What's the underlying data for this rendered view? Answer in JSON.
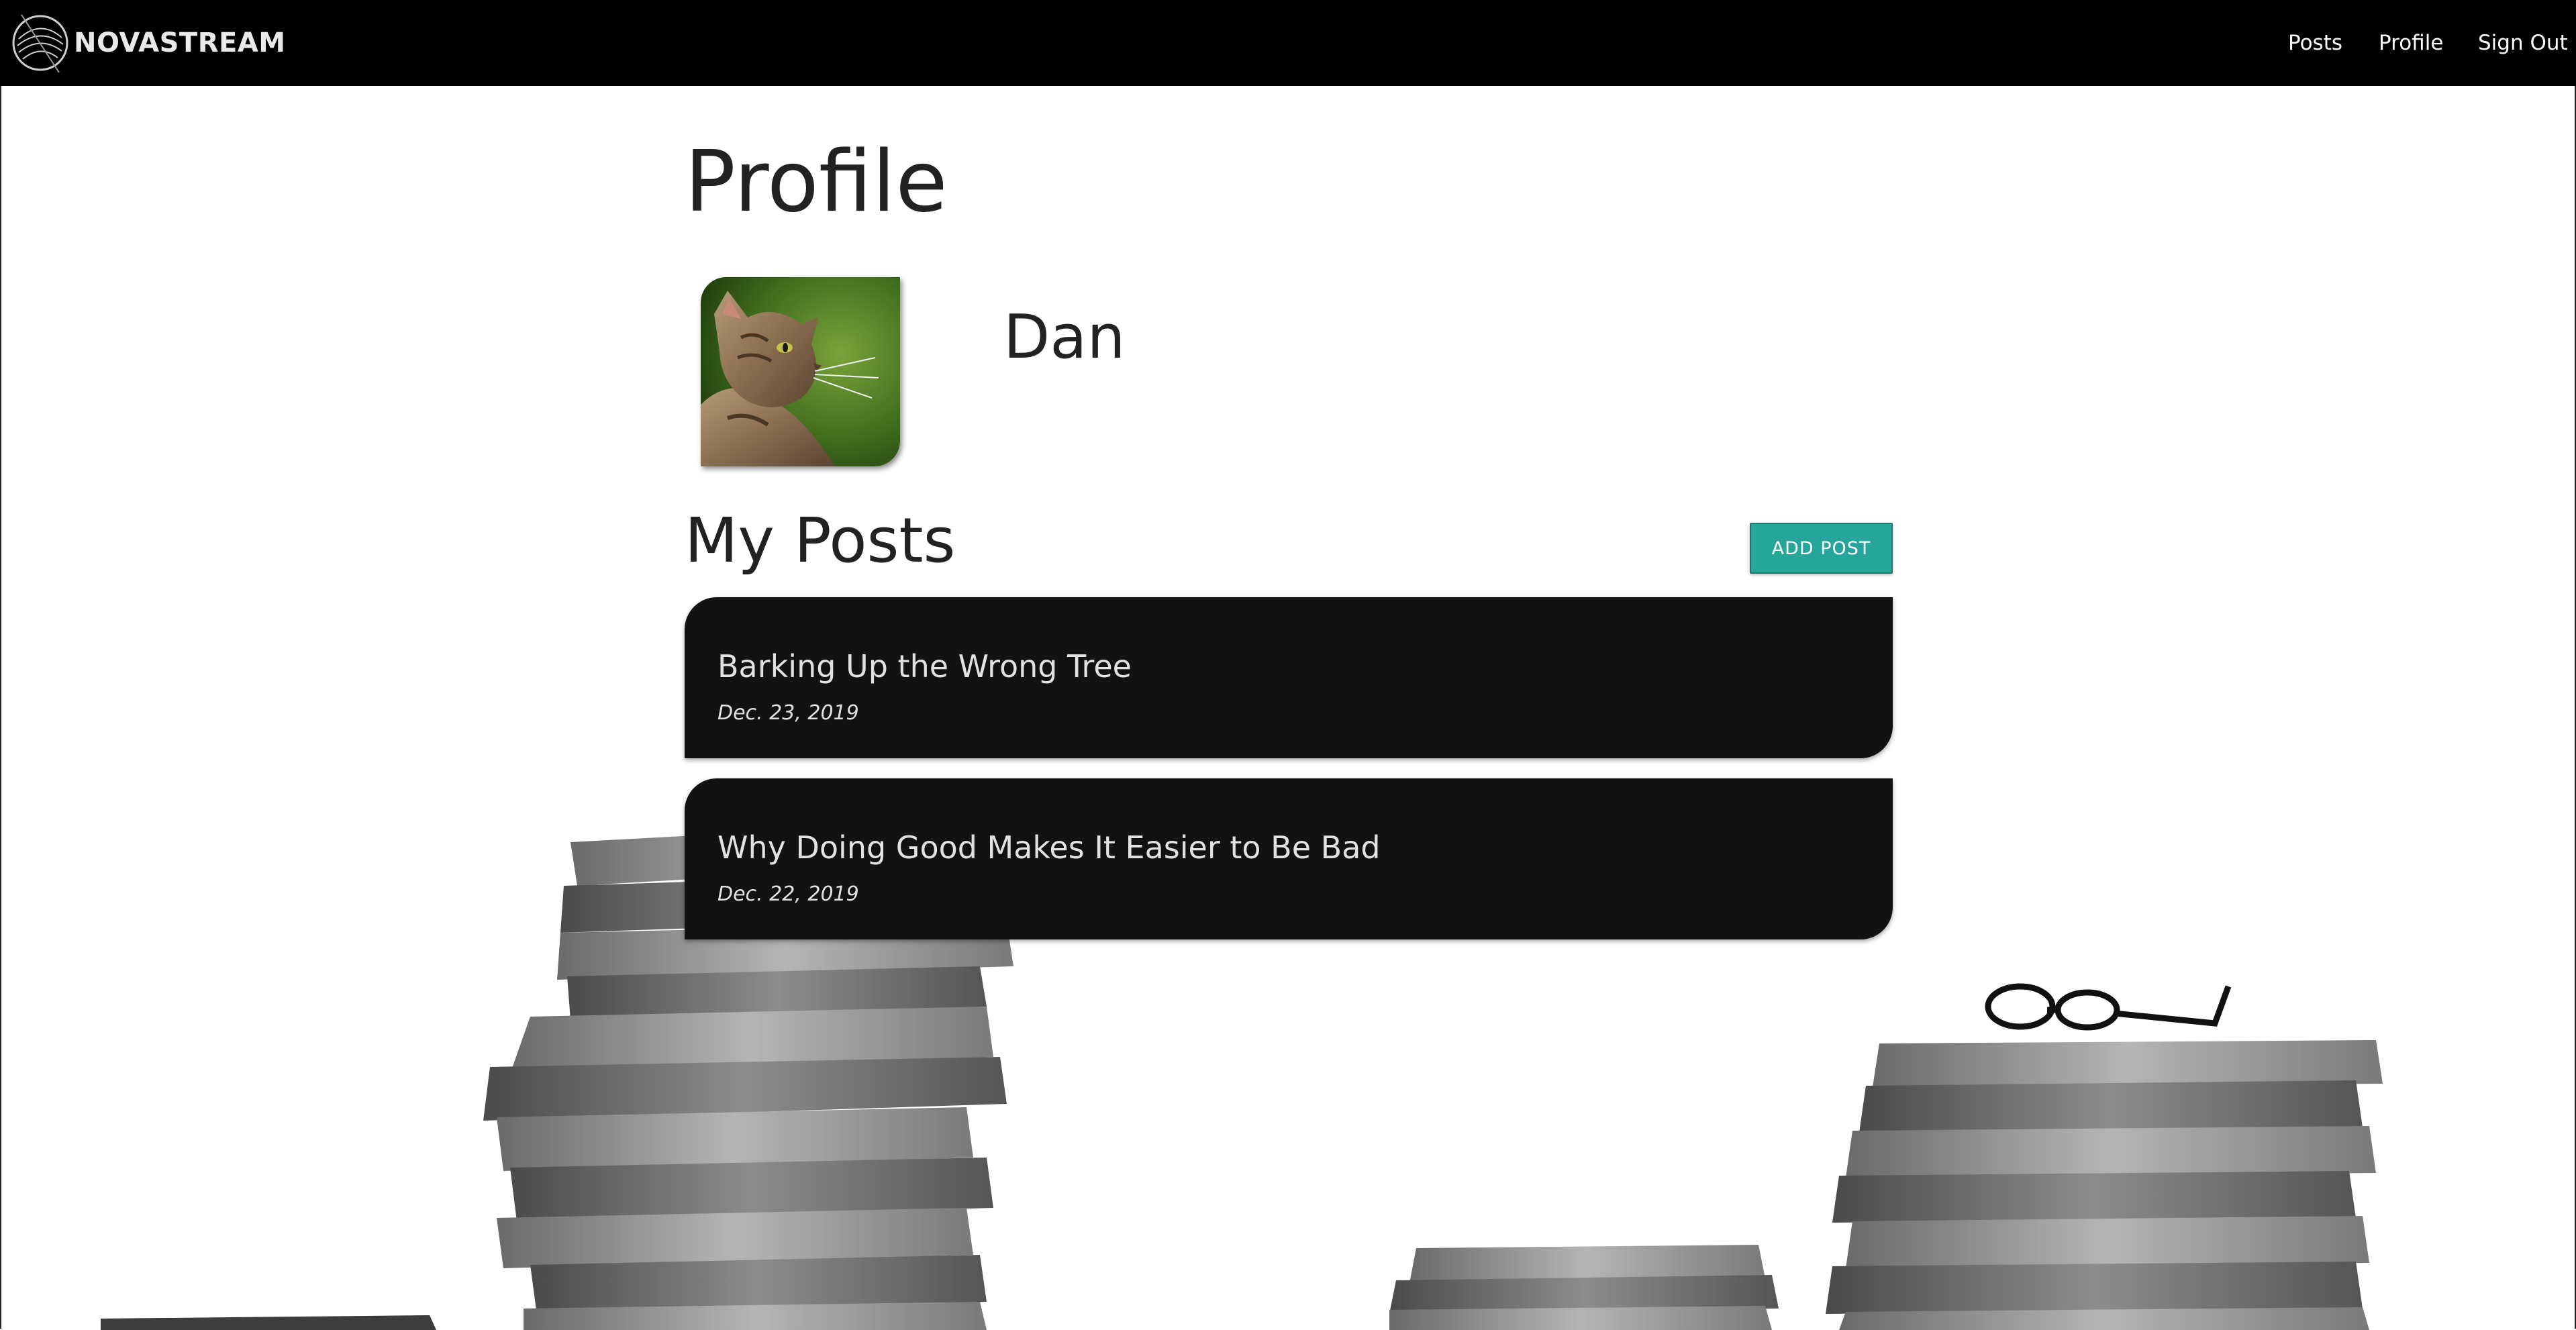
{
  "nav": {
    "brand": "NOVASTREAM",
    "links": [
      "Posts",
      "Profile",
      "Sign Out"
    ]
  },
  "page": {
    "title": "Profile",
    "username": "Dan",
    "posts_heading": "My Posts",
    "add_post_label": "ADD POST"
  },
  "posts": [
    {
      "title": "Barking Up the Wrong Tree",
      "date": "Dec. 23, 2019"
    },
    {
      "title": "Why Doing Good Makes It Easier to Be Bad",
      "date": "Dec. 22, 2019"
    }
  ],
  "colors": {
    "navbar": "#000000",
    "accent": "#26a69a",
    "card": "#121212",
    "text": "#222222"
  },
  "icons": [
    "brand-logo-icon",
    "profile-avatar-cat-image"
  ]
}
